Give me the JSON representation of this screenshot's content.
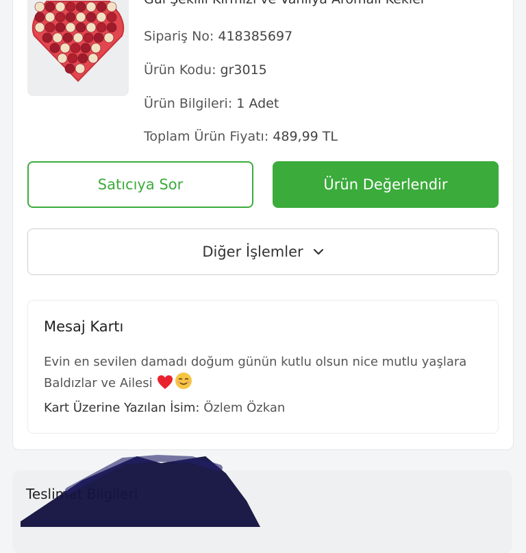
{
  "product": {
    "title": "Gül Şekilli Kırmızı ve Vanilya Aromalı Kekler",
    "order_no_label": "Sipariş No:",
    "order_no": "418385697",
    "code_label": "Ürün Kodu:",
    "code": "gr3015",
    "info_label": "Ürün Bilgileri:",
    "info": "1 Adet",
    "price_label": "Toplam Ürün Fiyatı:",
    "price": "489,99 TL"
  },
  "actions": {
    "ask_seller": "Satıcıya Sor",
    "rate_product": "Ürün Değerlendir",
    "other_actions": "Diğer İşlemler"
  },
  "message_card": {
    "title": "Mesaj Kartı",
    "text": "Evin en sevilen damadı doğum günün kutlu olsun nice mutlu yaşlara Baldızlar ve Ailesi",
    "name_label": "Kart Üzerine Yazılan İsim:",
    "name": "Özlem Özkan"
  },
  "delivery": {
    "title": "Teslimat Bilgileri"
  },
  "colors": {
    "primary_green": "#3bab3b",
    "heart": "#e8232e"
  },
  "icons": [
    "chevron-down-icon",
    "heart-emoji-icon",
    "smiling-emoji-icon"
  ]
}
